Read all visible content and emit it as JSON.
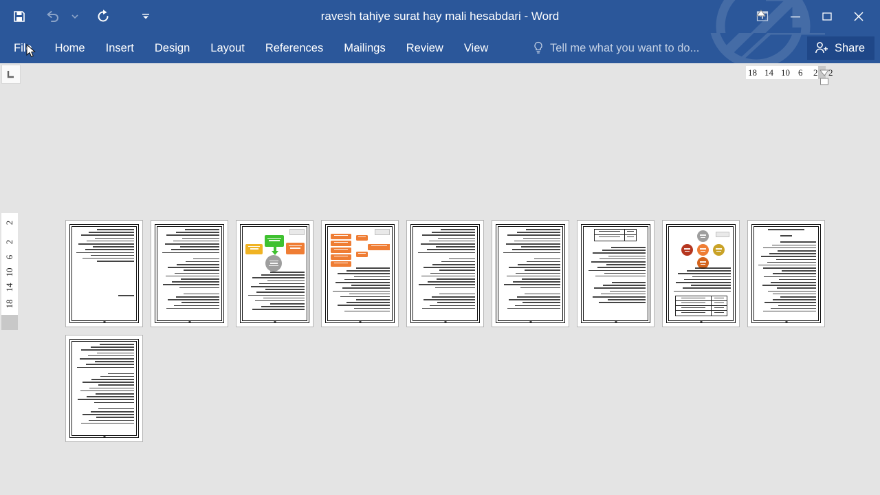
{
  "window": {
    "title": "ravesh tahiye surat hay mali hesabdari - Word",
    "app_name": "Word"
  },
  "quick_access": {
    "items": [
      {
        "name": "save",
        "label": "Save",
        "icon": "save-icon",
        "enabled": true
      },
      {
        "name": "undo",
        "label": "Undo",
        "icon": "undo-icon",
        "enabled": false
      },
      {
        "name": "undo-dropdown",
        "label": "Undo options",
        "icon": "chevron-down-icon",
        "enabled": false
      },
      {
        "name": "redo",
        "label": "Repeat",
        "icon": "redo-icon",
        "enabled": true
      },
      {
        "name": "customize",
        "label": "Customize Quick Access Toolbar",
        "icon": "chevron-down-icon",
        "enabled": true
      }
    ]
  },
  "window_controls": {
    "ribbon_display": "Ribbon Display Options",
    "minimize": "Minimize",
    "restore": "Restore Down",
    "close": "Close"
  },
  "ribbon": {
    "tabs": [
      {
        "label": "File",
        "active": false,
        "hovered": true
      },
      {
        "label": "Home",
        "active": false
      },
      {
        "label": "Insert",
        "active": false
      },
      {
        "label": "Design",
        "active": false
      },
      {
        "label": "Layout",
        "active": false
      },
      {
        "label": "References",
        "active": false
      },
      {
        "label": "Mailings",
        "active": false
      },
      {
        "label": "Review",
        "active": false
      },
      {
        "label": "View",
        "active": false
      }
    ],
    "tell_me_placeholder": "Tell me what you want to do...",
    "share_label": "Share",
    "collapsed": true
  },
  "rulers": {
    "tab_stop_marker": "L",
    "horizontal_ticks": [
      "18",
      "14",
      "10",
      "6",
      "2",
      "2"
    ],
    "vertical_ticks": [
      "2",
      "2",
      "6",
      "10",
      "14",
      "18"
    ]
  },
  "colors": {
    "title_bar": "#2b579a",
    "share_button": "#1f4788",
    "canvas_background": "#e4e4e4",
    "page_background": "#ffffff",
    "page_border": "#b4b4b4",
    "accent_green": "#3fc130",
    "accent_orange": "#ef7d34",
    "accent_yellow": "#f0b323",
    "accent_gray": "#9e9e9e",
    "accent_darkred": "#b5361f",
    "accent_olive": "#c9a227"
  },
  "document": {
    "zoom_layout": "multiple-pages",
    "total_pages": 10,
    "language_direction": "rtl",
    "pages": [
      {
        "number": 1,
        "type": "text",
        "has_diagram": false,
        "has_table": false
      },
      {
        "number": 2,
        "type": "text",
        "has_diagram": false,
        "has_table": false
      },
      {
        "number": 3,
        "type": "diagram-text",
        "has_diagram": true,
        "has_table": false,
        "diagram": "callout-smartart"
      },
      {
        "number": 4,
        "type": "diagram-text",
        "has_diagram": true,
        "has_table": false,
        "diagram": "orange-hierarchy"
      },
      {
        "number": 5,
        "type": "text",
        "has_diagram": false,
        "has_table": false
      },
      {
        "number": 6,
        "type": "text",
        "has_diagram": false,
        "has_table": false
      },
      {
        "number": 7,
        "type": "table-text",
        "has_diagram": false,
        "has_table": true
      },
      {
        "number": 8,
        "type": "diagram-table",
        "has_diagram": true,
        "has_table": true,
        "diagram": "cycle-circles"
      },
      {
        "number": 9,
        "type": "text",
        "has_diagram": false,
        "has_table": false
      },
      {
        "number": 10,
        "type": "text",
        "has_diagram": false,
        "has_table": false
      }
    ]
  }
}
